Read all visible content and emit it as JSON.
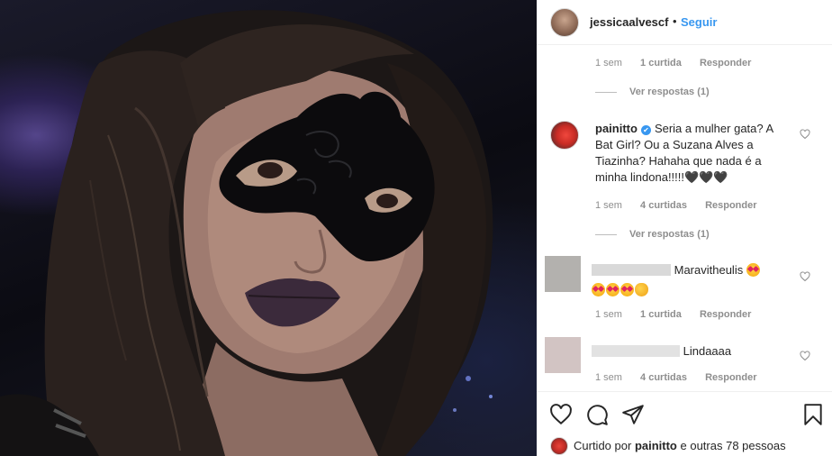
{
  "post": {
    "author": "jessicaalvescf",
    "dot": "•",
    "follow_label": "Seguir"
  },
  "comments": [
    {
      "time": "1 sem",
      "likes": "1 curtida",
      "reply_label": "Responder",
      "view_replies": "Ver respostas (1)"
    },
    {
      "username": "painitto",
      "verified_icon": "✔",
      "text": "Seria a mulher gata? A Bat Girl? Ou a Suzana Alves a Tiazinha? Hahaha que nada é a minha lindona!!!!!🖤🖤🖤",
      "time": "1 sem",
      "likes": "4 curtidas",
      "reply_label": "Responder",
      "view_replies": "Ver respostas (1)"
    },
    {
      "username_hidden": true,
      "text": "Maravitheulis",
      "emoji_icons": [
        "star-struck-emoji",
        "star-struck-emoji",
        "star-struck-emoji",
        "star-struck-emoji",
        "clapping-hands-emoji"
      ],
      "time": "1 sem",
      "likes": "1 curtida",
      "reply_label": "Responder"
    },
    {
      "username_hidden": true,
      "text": "Lindaaaa",
      "time": "1 sem",
      "likes": "4 curtidas",
      "reply_label": "Responder"
    }
  ],
  "actions": {
    "icons": [
      "heart-icon",
      "comment-icon",
      "share-icon",
      "bookmark-icon"
    ]
  },
  "liked_by": {
    "prefix": "Curtido por",
    "user": "painitto",
    "suffix": "e outras 78 pessoas"
  }
}
